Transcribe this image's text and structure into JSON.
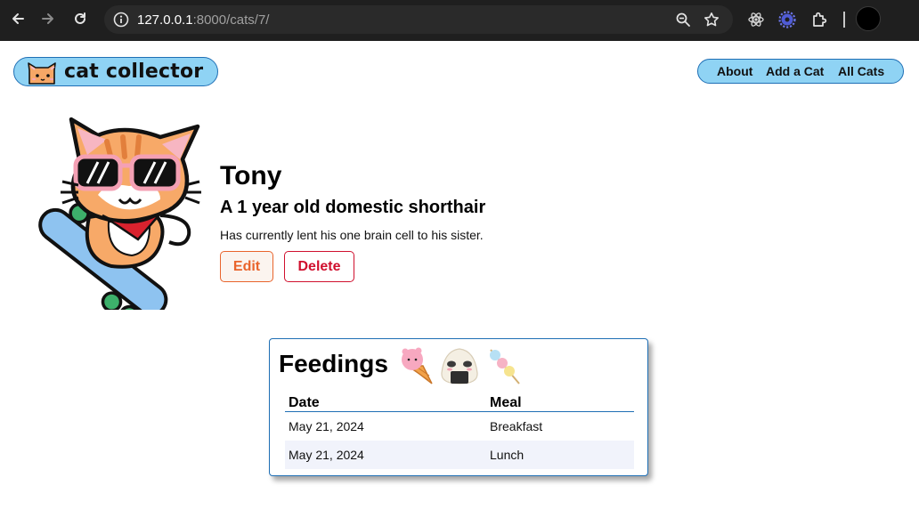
{
  "browser": {
    "url_host": "127.0.0.1",
    "url_rest": ":8000/cats/7/"
  },
  "navbar": {
    "logo_text": "cat collector",
    "links": [
      "About",
      "Add a Cat",
      "All Cats"
    ]
  },
  "cat": {
    "name": "Tony",
    "subtitle": "A 1 year old domestic shorthair",
    "description": "Has currently lent his one brain cell to his sister.",
    "edit_label": "Edit",
    "delete_label": "Delete"
  },
  "feedings": {
    "title": "Feedings",
    "columns": [
      "Date",
      "Meal"
    ],
    "rows": [
      {
        "date": "May 21, 2024",
        "meal": "Breakfast"
      },
      {
        "date": "May 21, 2024",
        "meal": "Lunch"
      }
    ]
  },
  "colors": {
    "accent_border": "#1f6fb5",
    "pill_fill": "#8fd3f4",
    "edit": "#e9642c",
    "delete": "#d0102e"
  }
}
